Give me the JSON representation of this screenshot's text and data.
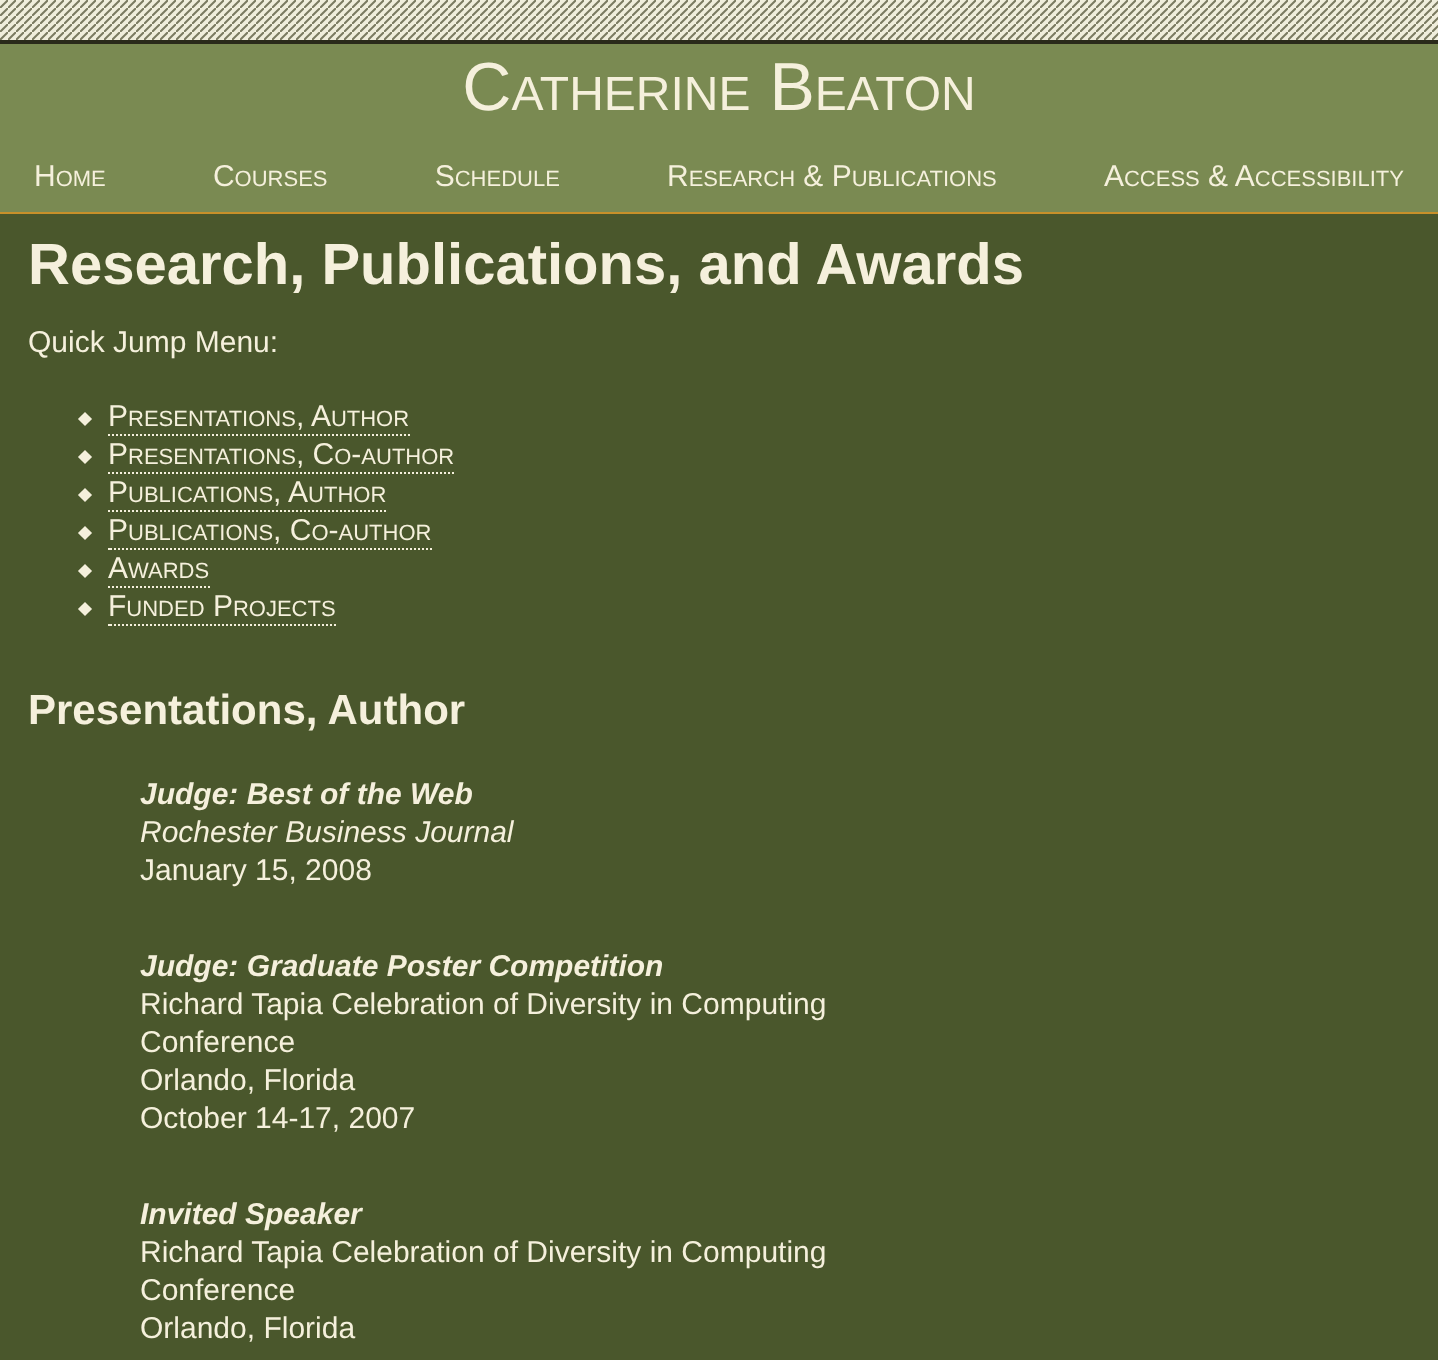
{
  "site_title": "Catherine Beaton",
  "nav": [
    "Home",
    "Courses",
    "Schedule",
    "Research & Publications",
    "Access & Accessibility"
  ],
  "heading": "Research, Publications, and Awards",
  "quick_jump_label": "Quick Jump Menu:",
  "quick_jump": [
    "Presentations, Author",
    "Presentations, Co-author",
    "Publications, Author",
    "Publications, Co-author",
    "Awards",
    "Funded Projects"
  ],
  "section": {
    "heading": "Presentations, Author",
    "entries": [
      {
        "title": "Judge: Best of the Web",
        "lines": [
          {
            "kind": "venue",
            "text": "Rochester Business Journal"
          },
          {
            "kind": "plain",
            "text": "January 15, 2008"
          }
        ]
      },
      {
        "title": "Judge: Graduate Poster Competition",
        "lines": [
          {
            "kind": "plain",
            "text": "Richard Tapia Celebration of Diversity in Computing Conference"
          },
          {
            "kind": "plain",
            "text": "Orlando, Florida"
          },
          {
            "kind": "plain",
            "text": "October 14-17, 2007"
          }
        ]
      },
      {
        "title": "Invited Speaker",
        "lines": [
          {
            "kind": "plain",
            "text": "Richard Tapia Celebration of Diversity in Computing Conference"
          },
          {
            "kind": "plain",
            "text": "Orlando, Florida"
          }
        ]
      }
    ]
  }
}
